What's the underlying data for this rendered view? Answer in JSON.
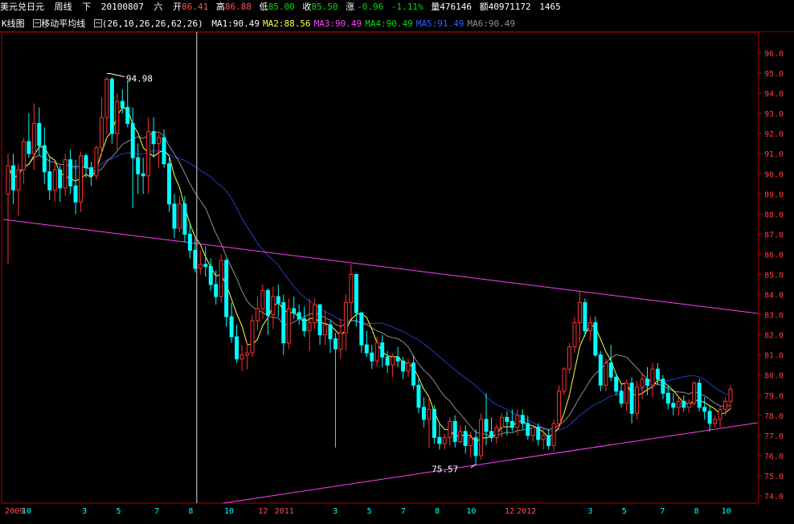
{
  "header": {
    "name": "美元兑日元",
    "period": "周线",
    "dir": "下",
    "date": "20100807",
    "weekday": "六",
    "open_label": "开",
    "open": "86.41",
    "high_label": "高",
    "high": "86.88",
    "low_label": "低",
    "low": "85.00",
    "close_label": "收",
    "close": "85.50",
    "change_label": "涨",
    "change": "-0.96",
    "change_pct": "-1.11%",
    "volume_label": "量",
    "volume": "476146",
    "amount_label": "额",
    "amount": "40971172",
    "extra": "1465"
  },
  "indicator_bar": {
    "kline_label": "K线图",
    "ma_label": "移动平均线",
    "params": "(26,10,26,26,62,26)",
    "ma": [
      {
        "label": "MA1:90.49",
        "color": "#ffffff"
      },
      {
        "label": "MA2:88.56",
        "color": "#ffff40"
      },
      {
        "label": "MA3:90.49",
        "color": "#ff40ff"
      },
      {
        "label": "MA4:90.49",
        "color": "#00e000"
      },
      {
        "label": "MA5:91.49",
        "color": "#3060ff"
      },
      {
        "label": "MA6:90.49",
        "color": "#909090"
      }
    ]
  },
  "chart_data": {
    "type": "candlestick",
    "instrument": "USD/JPY",
    "period": "weekly",
    "ylim": [
      74.0,
      96.5
    ],
    "y_ticks": [
      "96.0",
      "95.0",
      "94.0",
      "93.0",
      "92.0",
      "91.0",
      "90.0",
      "89.0",
      "88.0",
      "87.0",
      "86.0",
      "85.0",
      "84.0",
      "83.0",
      "82.0",
      "81.0",
      "80.0",
      "79.0",
      "78.0",
      "77.0",
      "76.0",
      "75.0",
      "74.0"
    ],
    "x_labels": [
      "2009",
      "10",
      "3",
      "5",
      "7",
      "8",
      "10",
      "12",
      "2011",
      "3",
      "5",
      "7",
      "8",
      "10",
      "12",
      "2012",
      "3",
      "5",
      "7",
      "8",
      "10"
    ],
    "x_label_colors": [
      "#ff5050",
      "#00ffff",
      "#00ffff",
      "#00ffff",
      "#00ffff",
      "#00ffff",
      "#00ffff",
      "#ff5050",
      "#ff5050",
      "#00ffff",
      "#00ffff",
      "#00ffff",
      "#00ffff",
      "#00ffff",
      "#ff5050",
      "#ff5050",
      "#00ffff",
      "#00ffff",
      "#00ffff",
      "#00ffff",
      "#00ffff"
    ],
    "candles": [
      [
        89.0,
        91.0,
        85.5,
        90.4
      ],
      [
        90.4,
        91.0,
        88.5,
        89.2
      ],
      [
        89.2,
        90.5,
        87.9,
        90.2
      ],
      [
        90.2,
        91.8,
        89.5,
        91.6
      ],
      [
        91.6,
        93.0,
        90.8,
        91.0
      ],
      [
        91.0,
        93.5,
        90.2,
        92.5
      ],
      [
        92.5,
        93.3,
        90.9,
        91.4
      ],
      [
        91.4,
        92.3,
        89.5,
        90.1
      ],
      [
        90.1,
        90.9,
        88.7,
        89.2
      ],
      [
        89.2,
        90.6,
        88.6,
        90.2
      ],
      [
        90.2,
        90.4,
        88.6,
        89.3
      ],
      [
        89.3,
        91.0,
        88.9,
        90.7
      ],
      [
        90.7,
        91.2,
        89.0,
        89.4
      ],
      [
        89.4,
        90.7,
        88.0,
        88.6
      ],
      [
        88.6,
        91.1,
        88.1,
        90.9
      ],
      [
        90.9,
        91.0,
        89.8,
        90.3
      ],
      [
        90.3,
        90.6,
        89.4,
        89.9
      ],
      [
        89.9,
        91.4,
        89.7,
        91.3
      ],
      [
        91.3,
        93.8,
        90.9,
        92.8
      ],
      [
        92.8,
        94.8,
        92.0,
        94.7
      ],
      [
        94.7,
        94.8,
        91.5,
        92.0
      ],
      [
        92.0,
        94.0,
        91.2,
        93.6
      ],
      [
        93.6,
        94.2,
        93.0,
        93.3
      ],
      [
        93.3,
        94.6,
        92.3,
        92.5
      ],
      [
        92.5,
        93.3,
        88.3,
        90.8
      ],
      [
        90.8,
        91.5,
        89.0,
        90.0
      ],
      [
        90.0,
        90.8,
        89.0,
        89.9
      ],
      [
        89.9,
        92.8,
        89.0,
        92.1
      ],
      [
        92.1,
        92.8,
        90.8,
        91.5
      ],
      [
        91.5,
        92.0,
        90.3,
        91.8
      ],
      [
        91.8,
        92.2,
        90.3,
        90.5
      ],
      [
        90.5,
        90.9,
        88.1,
        88.5
      ],
      [
        88.5,
        89.0,
        86.8,
        87.3
      ],
      [
        87.3,
        88.9,
        87.1,
        88.5
      ],
      [
        88.5,
        88.9,
        86.6,
        87.0
      ],
      [
        87.0,
        87.5,
        85.8,
        86.2
      ],
      [
        86.2,
        86.8,
        85.1,
        85.3
      ],
      [
        85.3,
        86.2,
        85.0,
        85.5
      ],
      [
        85.5,
        86.4,
        84.9,
        85.4
      ],
      [
        85.4,
        85.8,
        84.2,
        84.5
      ],
      [
        84.5,
        85.2,
        83.5,
        83.9
      ],
      [
        83.9,
        86.0,
        83.6,
        85.7
      ],
      [
        85.7,
        85.8,
        82.4,
        82.9
      ],
      [
        82.9,
        83.6,
        81.6,
        81.9
      ],
      [
        81.9,
        82.5,
        80.6,
        80.8
      ],
      [
        80.8,
        81.5,
        80.2,
        81.0
      ],
      [
        81.0,
        81.6,
        80.3,
        81.1
      ],
      [
        81.1,
        83.0,
        80.9,
        82.7
      ],
      [
        82.7,
        83.9,
        82.2,
        83.3
      ],
      [
        83.3,
        84.5,
        82.8,
        84.2
      ],
      [
        84.2,
        84.3,
        82.0,
        83.0
      ],
      [
        83.0,
        84.4,
        82.3,
        83.9
      ],
      [
        83.9,
        84.5,
        82.9,
        83.6
      ],
      [
        83.6,
        84.0,
        81.0,
        81.6
      ],
      [
        81.6,
        83.8,
        81.3,
        83.3
      ],
      [
        83.3,
        83.9,
        82.8,
        83.1
      ],
      [
        83.1,
        83.5,
        82.5,
        82.8
      ],
      [
        82.8,
        83.4,
        81.9,
        82.2
      ],
      [
        82.2,
        83.8,
        81.2,
        82.6
      ],
      [
        82.6,
        83.8,
        82.3,
        83.5
      ],
      [
        83.5,
        83.5,
        81.5,
        82.0
      ],
      [
        82.0,
        83.2,
        81.5,
        82.5
      ],
      [
        82.5,
        82.7,
        81.1,
        81.8
      ],
      [
        81.8,
        82.1,
        76.4,
        81.3
      ],
      [
        81.3,
        82.8,
        80.8,
        82.1
      ],
      [
        82.1,
        84.0,
        81.2,
        83.6
      ],
      [
        83.6,
        85.5,
        82.8,
        85.0
      ],
      [
        85.0,
        85.0,
        82.4,
        83.1
      ],
      [
        83.1,
        83.1,
        81.1,
        81.5
      ],
      [
        81.5,
        82.2,
        80.9,
        81.1
      ],
      [
        81.1,
        81.5,
        80.3,
        80.7
      ],
      [
        80.7,
        81.9,
        80.4,
        81.6
      ],
      [
        81.6,
        82.0,
        80.4,
        80.9
      ],
      [
        80.9,
        81.2,
        80.1,
        80.5
      ],
      [
        80.5,
        81.1,
        79.9,
        80.9
      ],
      [
        80.9,
        81.4,
        80.4,
        80.7
      ],
      [
        80.7,
        80.9,
        79.8,
        80.2
      ],
      [
        80.2,
        80.8,
        79.9,
        80.6
      ],
      [
        80.6,
        81.0,
        79.3,
        79.5
      ],
      [
        79.5,
        79.8,
        78.1,
        78.4
      ],
      [
        78.4,
        78.9,
        77.4,
        77.8
      ],
      [
        77.8,
        78.9,
        76.4,
        78.3
      ],
      [
        78.3,
        78.5,
        76.6,
        76.9
      ],
      [
        76.9,
        77.6,
        76.3,
        76.6
      ],
      [
        76.6,
        77.1,
        76.3,
        76.9
      ],
      [
        76.9,
        77.9,
        76.5,
        77.7
      ],
      [
        77.7,
        78.0,
        76.4,
        76.7
      ],
      [
        76.7,
        77.5,
        76.6,
        77.2
      ],
      [
        77.2,
        77.5,
        76.1,
        76.5
      ],
      [
        76.5,
        77.2,
        75.9,
        76.9
      ],
      [
        76.9,
        77.3,
        75.57,
        76.0
      ],
      [
        76.0,
        78.1,
        75.8,
        77.8
      ],
      [
        77.8,
        79.1,
        76.5,
        77.2
      ],
      [
        77.2,
        77.9,
        76.7,
        76.9
      ],
      [
        76.9,
        77.6,
        76.6,
        77.4
      ],
      [
        77.4,
        78.1,
        76.9,
        77.9
      ],
      [
        77.9,
        78.2,
        77.0,
        77.7
      ],
      [
        77.7,
        78.3,
        77.2,
        77.4
      ],
      [
        77.4,
        78.3,
        77.0,
        78.0
      ],
      [
        78.0,
        78.3,
        77.3,
        77.6
      ],
      [
        77.6,
        78.0,
        76.8,
        77.0
      ],
      [
        77.0,
        77.5,
        76.7,
        77.4
      ],
      [
        77.4,
        77.6,
        76.5,
        76.8
      ],
      [
        76.8,
        77.4,
        76.3,
        77.0
      ],
      [
        77.0,
        77.3,
        76.3,
        76.5
      ],
      [
        76.5,
        77.8,
        76.2,
        77.6
      ],
      [
        77.6,
        79.5,
        77.3,
        79.2
      ],
      [
        79.2,
        80.4,
        79.0,
        80.3
      ],
      [
        80.3,
        81.6,
        80.1,
        81.4
      ],
      [
        81.4,
        82.9,
        81.1,
        82.6
      ],
      [
        82.6,
        84.2,
        81.6,
        83.6
      ],
      [
        83.6,
        83.8,
        81.9,
        82.2
      ],
      [
        82.2,
        82.9,
        81.7,
        82.6
      ],
      [
        82.6,
        82.9,
        80.9,
        81.0
      ],
      [
        81.0,
        81.2,
        79.2,
        79.5
      ],
      [
        79.5,
        80.8,
        79.2,
        80.6
      ],
      [
        80.6,
        81.5,
        79.7,
        79.9
      ],
      [
        79.9,
        80.1,
        79.0,
        79.2
      ],
      [
        79.2,
        79.6,
        78.4,
        78.6
      ],
      [
        78.6,
        79.8,
        78.2,
        79.6
      ],
      [
        79.6,
        79.9,
        77.6,
        78.1
      ],
      [
        78.1,
        79.7,
        77.8,
        79.4
      ],
      [
        79.4,
        80.1,
        78.8,
        79.8
      ],
      [
        79.8,
        80.4,
        79.0,
        79.5
      ],
      [
        79.5,
        80.6,
        78.9,
        80.3
      ],
      [
        80.3,
        80.6,
        79.5,
        79.8
      ],
      [
        79.8,
        80.0,
        78.8,
        79.1
      ],
      [
        79.1,
        79.5,
        78.3,
        78.6
      ],
      [
        78.6,
        79.1,
        78.0,
        78.4
      ],
      [
        78.4,
        78.9,
        78.0,
        78.7
      ],
      [
        78.7,
        79.0,
        78.2,
        78.4
      ],
      [
        78.4,
        78.8,
        78.1,
        78.6
      ],
      [
        78.6,
        79.7,
        78.5,
        79.6
      ],
      [
        79.6,
        79.8,
        78.2,
        78.4
      ],
      [
        78.4,
        78.9,
        77.8,
        78.2
      ],
      [
        78.2,
        78.5,
        77.2,
        77.6
      ],
      [
        77.6,
        78.0,
        77.4,
        77.8
      ],
      [
        77.8,
        78.5,
        77.4,
        78.3
      ],
      [
        78.3,
        78.9,
        78.0,
        78.7
      ],
      [
        78.7,
        79.5,
        78.3,
        79.3
      ]
    ],
    "annotations": [
      {
        "text": "94.98",
        "price": 94.98,
        "index": 19
      },
      {
        "text": "75.57",
        "price": 75.57,
        "index": 90
      }
    ],
    "cursor_index": 36,
    "ma_lines": [
      "MA short (yellow)",
      "MA mid (gray)",
      "MA long (blue)"
    ],
    "trendlines": [
      "upper resistance (magenta)",
      "lower support (magenta)"
    ]
  },
  "colors": {
    "up_candle": "#ff3030",
    "down_candle": "#00ffff",
    "frame": "#b00000",
    "axis_text": "#ff4040",
    "ma_short": "#ffff40",
    "ma_mid": "#909090",
    "ma_long": "#2040c0",
    "trendline": "#ff40ff",
    "cursor": "#e0e0e0",
    "annotation": "#ffffff"
  }
}
